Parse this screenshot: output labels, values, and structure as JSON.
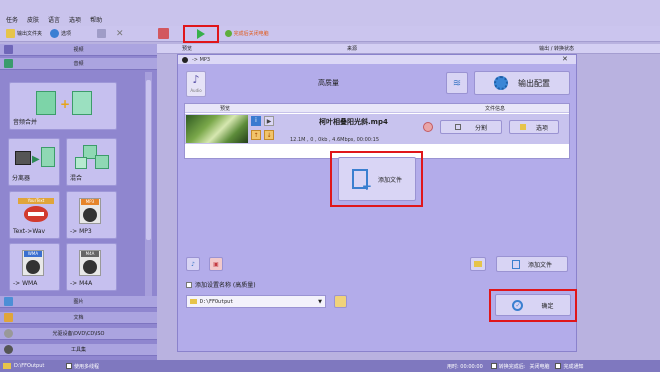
{
  "menu": [
    "任务",
    "皮肤",
    "语言",
    "选项",
    "帮助"
  ],
  "toolbar": {
    "output_folder": "输出文件夹",
    "options": "选项",
    "shutdown_after": "完成后关闭电脑",
    "colors": {
      "play_green": "#37b04a",
      "stop_red": "#d2575f",
      "highlight": "#e0161a"
    }
  },
  "columns": {
    "preview": "预览",
    "source": "来源",
    "output_status": "输出 / 转换状态"
  },
  "sidebar": {
    "video": "视频",
    "audio": "音频",
    "picture": "图片",
    "document": "文档",
    "rom": "光驱设备\\DVD\\CD\\ISO",
    "toolbox": "工具集",
    "tiles": [
      {
        "label": "音频合并",
        "icon": "music-merge-icon"
      },
      {
        "label": "分离器",
        "icon": "splitter-icon"
      },
      {
        "label": "混合",
        "icon": "mix-icon"
      },
      {
        "label": "Text->Wav",
        "icon": "text-to-speech-icon"
      },
      {
        "label": "-> MP3",
        "icon": "mp3-icon",
        "badge": "MP3"
      },
      {
        "label": "-> WMA",
        "icon": "wma-icon",
        "badge": "WMA"
      },
      {
        "label": "-> M4A",
        "icon": "m4a-icon",
        "badge": "M4A"
      }
    ]
  },
  "dialog": {
    "title": "-> MP3",
    "audio_label": "Audio",
    "quality": "高质量",
    "output_config": "输出配置",
    "col_preview": "预览",
    "col_fileinfo": "文件信息",
    "file_name": "柯叶相叠阳光斜.mp4",
    "file_meta": "12.1M , 0 , 0kb , 4.6Mbps, 00:00:15",
    "split": "分割",
    "options": "选项",
    "add_file_center": "添加文件",
    "add_file": "添加文件",
    "checkbox_label": "添加设置名称 (高质量)",
    "output_path": "D:\\FFOutput",
    "ok": "确定"
  },
  "status": {
    "path": "D:\\FFOutput",
    "use_multithread": "使用多线程",
    "elapsed": "用时: 00:00:00",
    "after_convert": "转换完成后:",
    "close_pc": "关闭电脑",
    "notify_sound": "完成通知"
  }
}
